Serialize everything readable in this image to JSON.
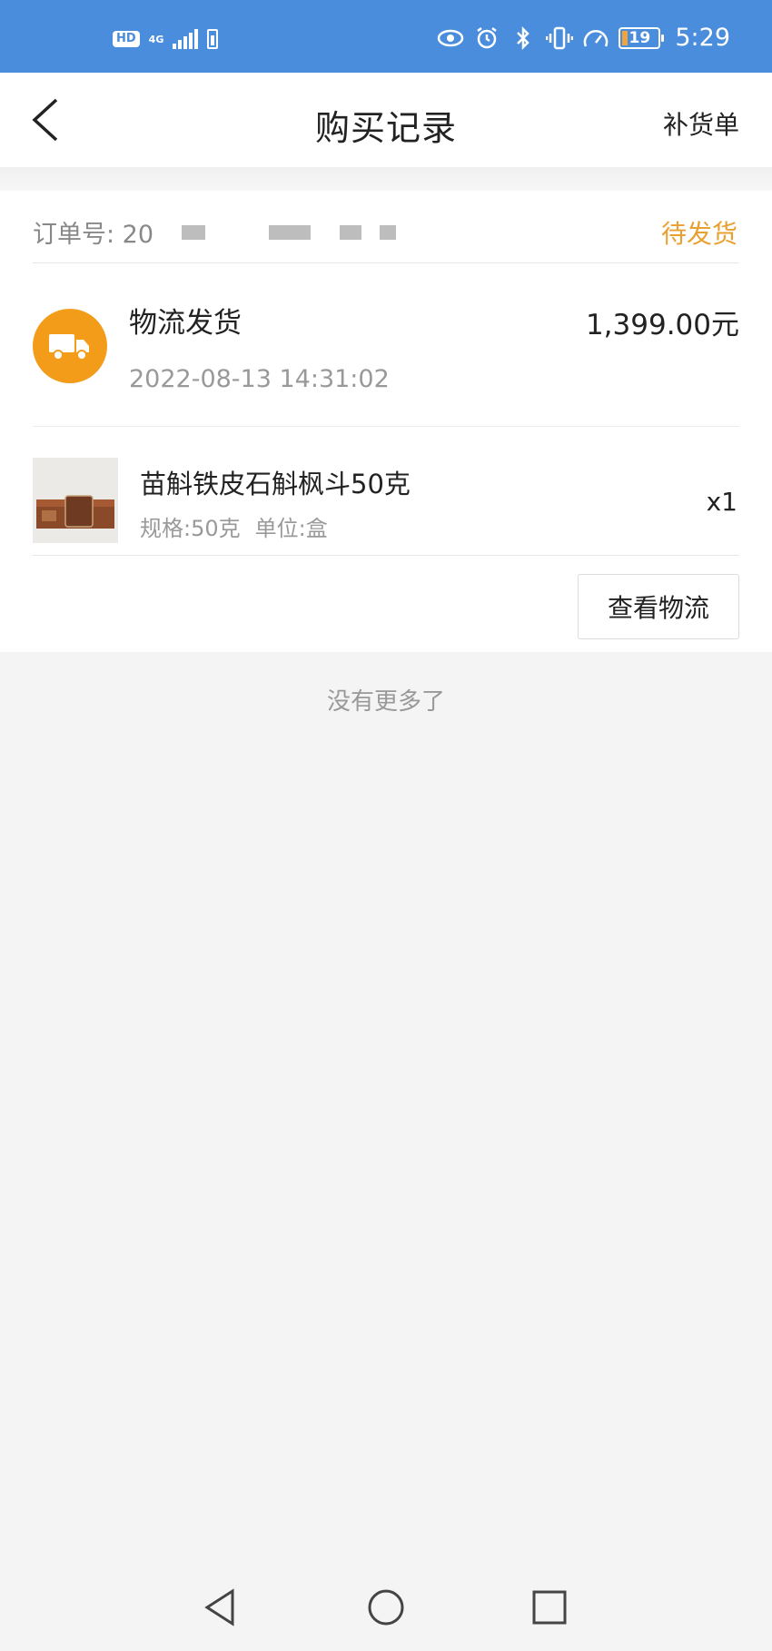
{
  "status_bar": {
    "hd": "HD",
    "network": "4G",
    "time": "5:29",
    "battery_level": "19",
    "icons": [
      "eye-icon",
      "alarm-icon",
      "bluetooth-icon",
      "vibrate-icon",
      "speed-icon"
    ]
  },
  "header": {
    "title": "购买记录",
    "action": "补货单"
  },
  "order": {
    "number_label": "订单号: 20",
    "status": "待发货",
    "shipping_method": "物流发货",
    "shipping_time": "2022-08-13 14:31:02",
    "amount": "1,399.00元",
    "product": {
      "name": "苗斛铁皮石斛枫斗50克",
      "spec": "规格:50克",
      "unit": "单位:盒",
      "quantity": "x1"
    },
    "logistics_button": "查看物流"
  },
  "footer_text": "没有更多了",
  "colors": {
    "status_bar": "#4a8ddc",
    "accent_orange": "#f39c1a",
    "status_text": "#e8a030"
  }
}
